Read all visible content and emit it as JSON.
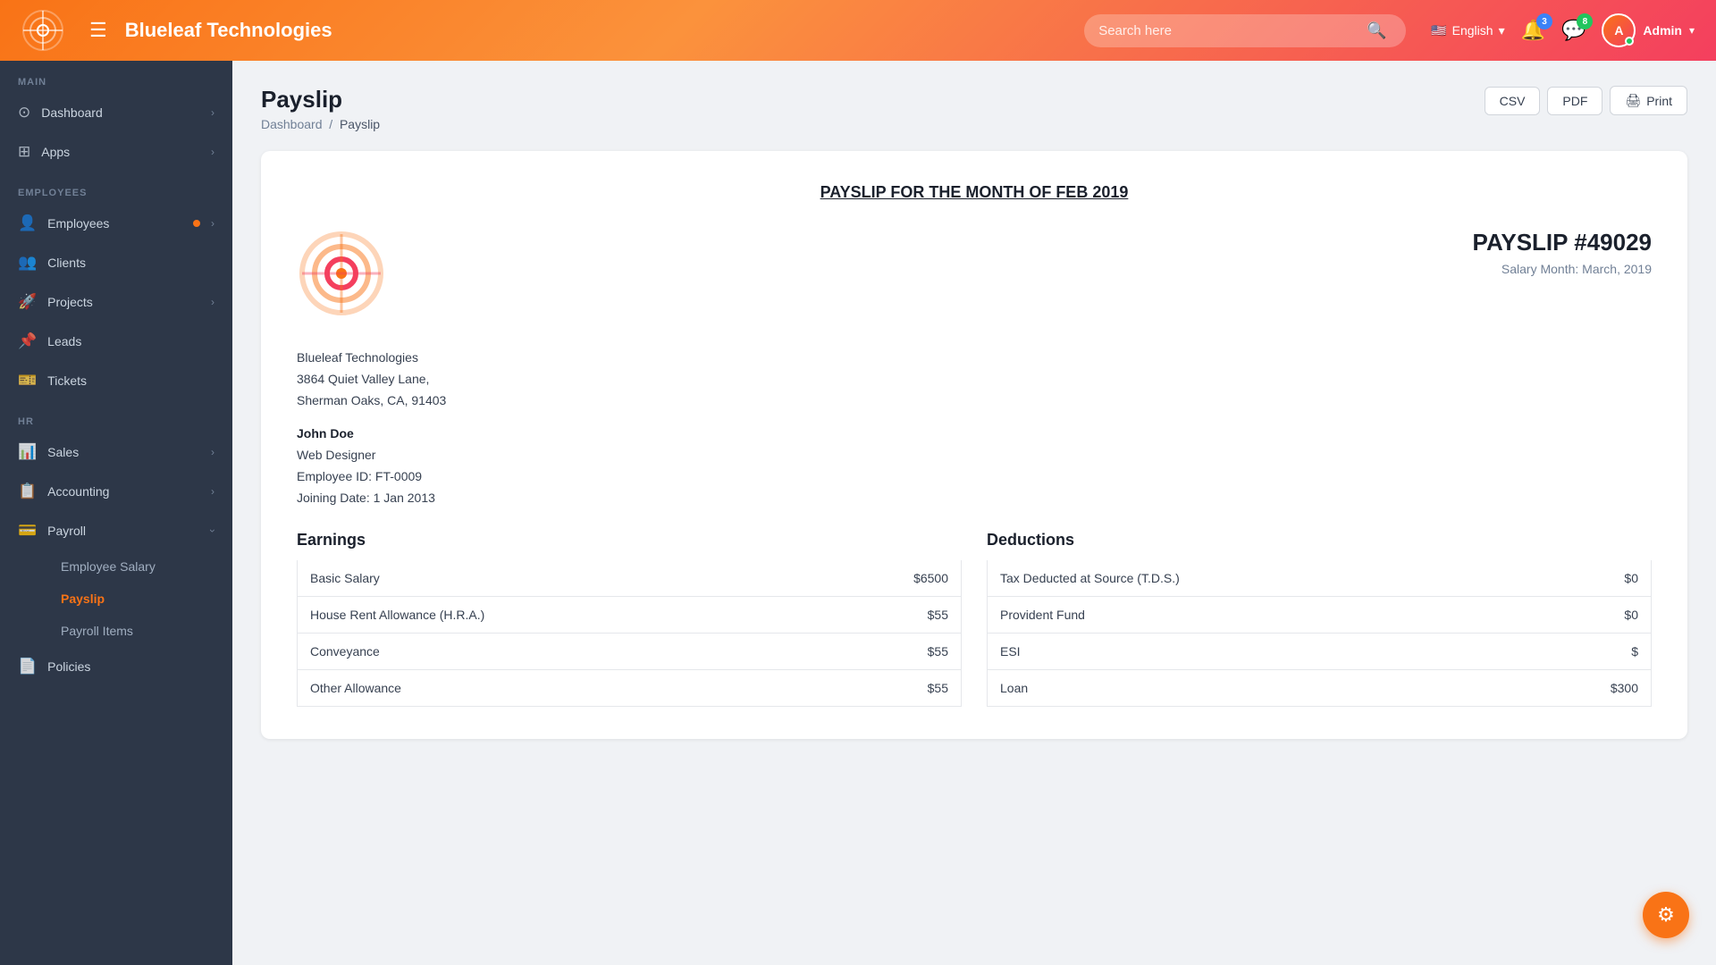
{
  "app": {
    "title": "Blueleaf Technologies",
    "logo_alt": "Blueleaf Logo"
  },
  "topnav": {
    "hamburger": "☰",
    "title": "Blueleaf Technologies",
    "search_placeholder": "Search here",
    "lang": "English",
    "notifications_count": "3",
    "messages_count": "8",
    "admin_label": "Admin"
  },
  "sidebar": {
    "sections": [
      {
        "label": "Main",
        "items": [
          {
            "id": "dashboard",
            "icon": "⊙",
            "label": "Dashboard",
            "has_chevron": true
          },
          {
            "id": "apps",
            "icon": "⊞",
            "label": "Apps",
            "has_chevron": true
          }
        ]
      },
      {
        "label": "Employees",
        "items": [
          {
            "id": "employees",
            "icon": "👤",
            "label": "Employees",
            "has_chevron": true,
            "has_dot": true
          },
          {
            "id": "clients",
            "icon": "👥",
            "label": "Clients",
            "has_chevron": false
          },
          {
            "id": "projects",
            "icon": "🚀",
            "label": "Projects",
            "has_chevron": true
          },
          {
            "id": "leads",
            "icon": "📌",
            "label": "Leads",
            "has_chevron": false
          },
          {
            "id": "tickets",
            "icon": "🎫",
            "label": "Tickets",
            "has_chevron": false
          }
        ]
      },
      {
        "label": "HR",
        "items": [
          {
            "id": "sales",
            "icon": "📊",
            "label": "Sales",
            "has_chevron": true
          },
          {
            "id": "accounting",
            "icon": "📋",
            "label": "Accounting",
            "has_chevron": true
          },
          {
            "id": "payroll",
            "icon": "💳",
            "label": "Payroll",
            "has_chevron": true,
            "expanded": true
          }
        ]
      }
    ],
    "payroll_sub_items": [
      {
        "id": "employee-salary",
        "label": "Employee Salary",
        "active": false
      },
      {
        "id": "payslip",
        "label": "Payslip",
        "active": true
      },
      {
        "id": "payroll-items",
        "label": "Payroll Items",
        "active": false
      }
    ],
    "policies_item": {
      "id": "policies",
      "icon": "📄",
      "label": "Policies"
    }
  },
  "page": {
    "title": "Payslip",
    "breadcrumb_home": "Dashboard",
    "breadcrumb_current": "Payslip",
    "btn_csv": "CSV",
    "btn_pdf": "PDF",
    "btn_print": "Print"
  },
  "payslip": {
    "heading": "PAYSLIP FOR THE MONTH OF FEB 2019",
    "number": "PAYSLIP #49029",
    "salary_month_label": "Salary Month:",
    "salary_month_value": "March, 2019",
    "company_name": "Blueleaf Technologies",
    "company_address_1": "3864 Quiet Valley Lane,",
    "company_address_2": "Sherman Oaks, CA, 91403",
    "employee_name": "John Doe",
    "employee_role": "Web Designer",
    "employee_id": "Employee ID: FT-0009",
    "joining_date": "Joining Date: 1 Jan 2013",
    "earnings_title": "Earnings",
    "deductions_title": "Deductions",
    "earnings": [
      {
        "label": "Basic Salary",
        "amount": "$6500"
      },
      {
        "label": "House Rent Allowance (H.R.A.)",
        "amount": "$55"
      },
      {
        "label": "Conveyance",
        "amount": "$55"
      },
      {
        "label": "Other Allowance",
        "amount": "$55"
      }
    ],
    "deductions": [
      {
        "label": "Tax Deducted at Source (T.D.S.)",
        "amount": "$0"
      },
      {
        "label": "Provident Fund",
        "amount": "$0"
      },
      {
        "label": "ESI",
        "amount": "$"
      },
      {
        "label": "Loan",
        "amount": "$300"
      }
    ]
  }
}
